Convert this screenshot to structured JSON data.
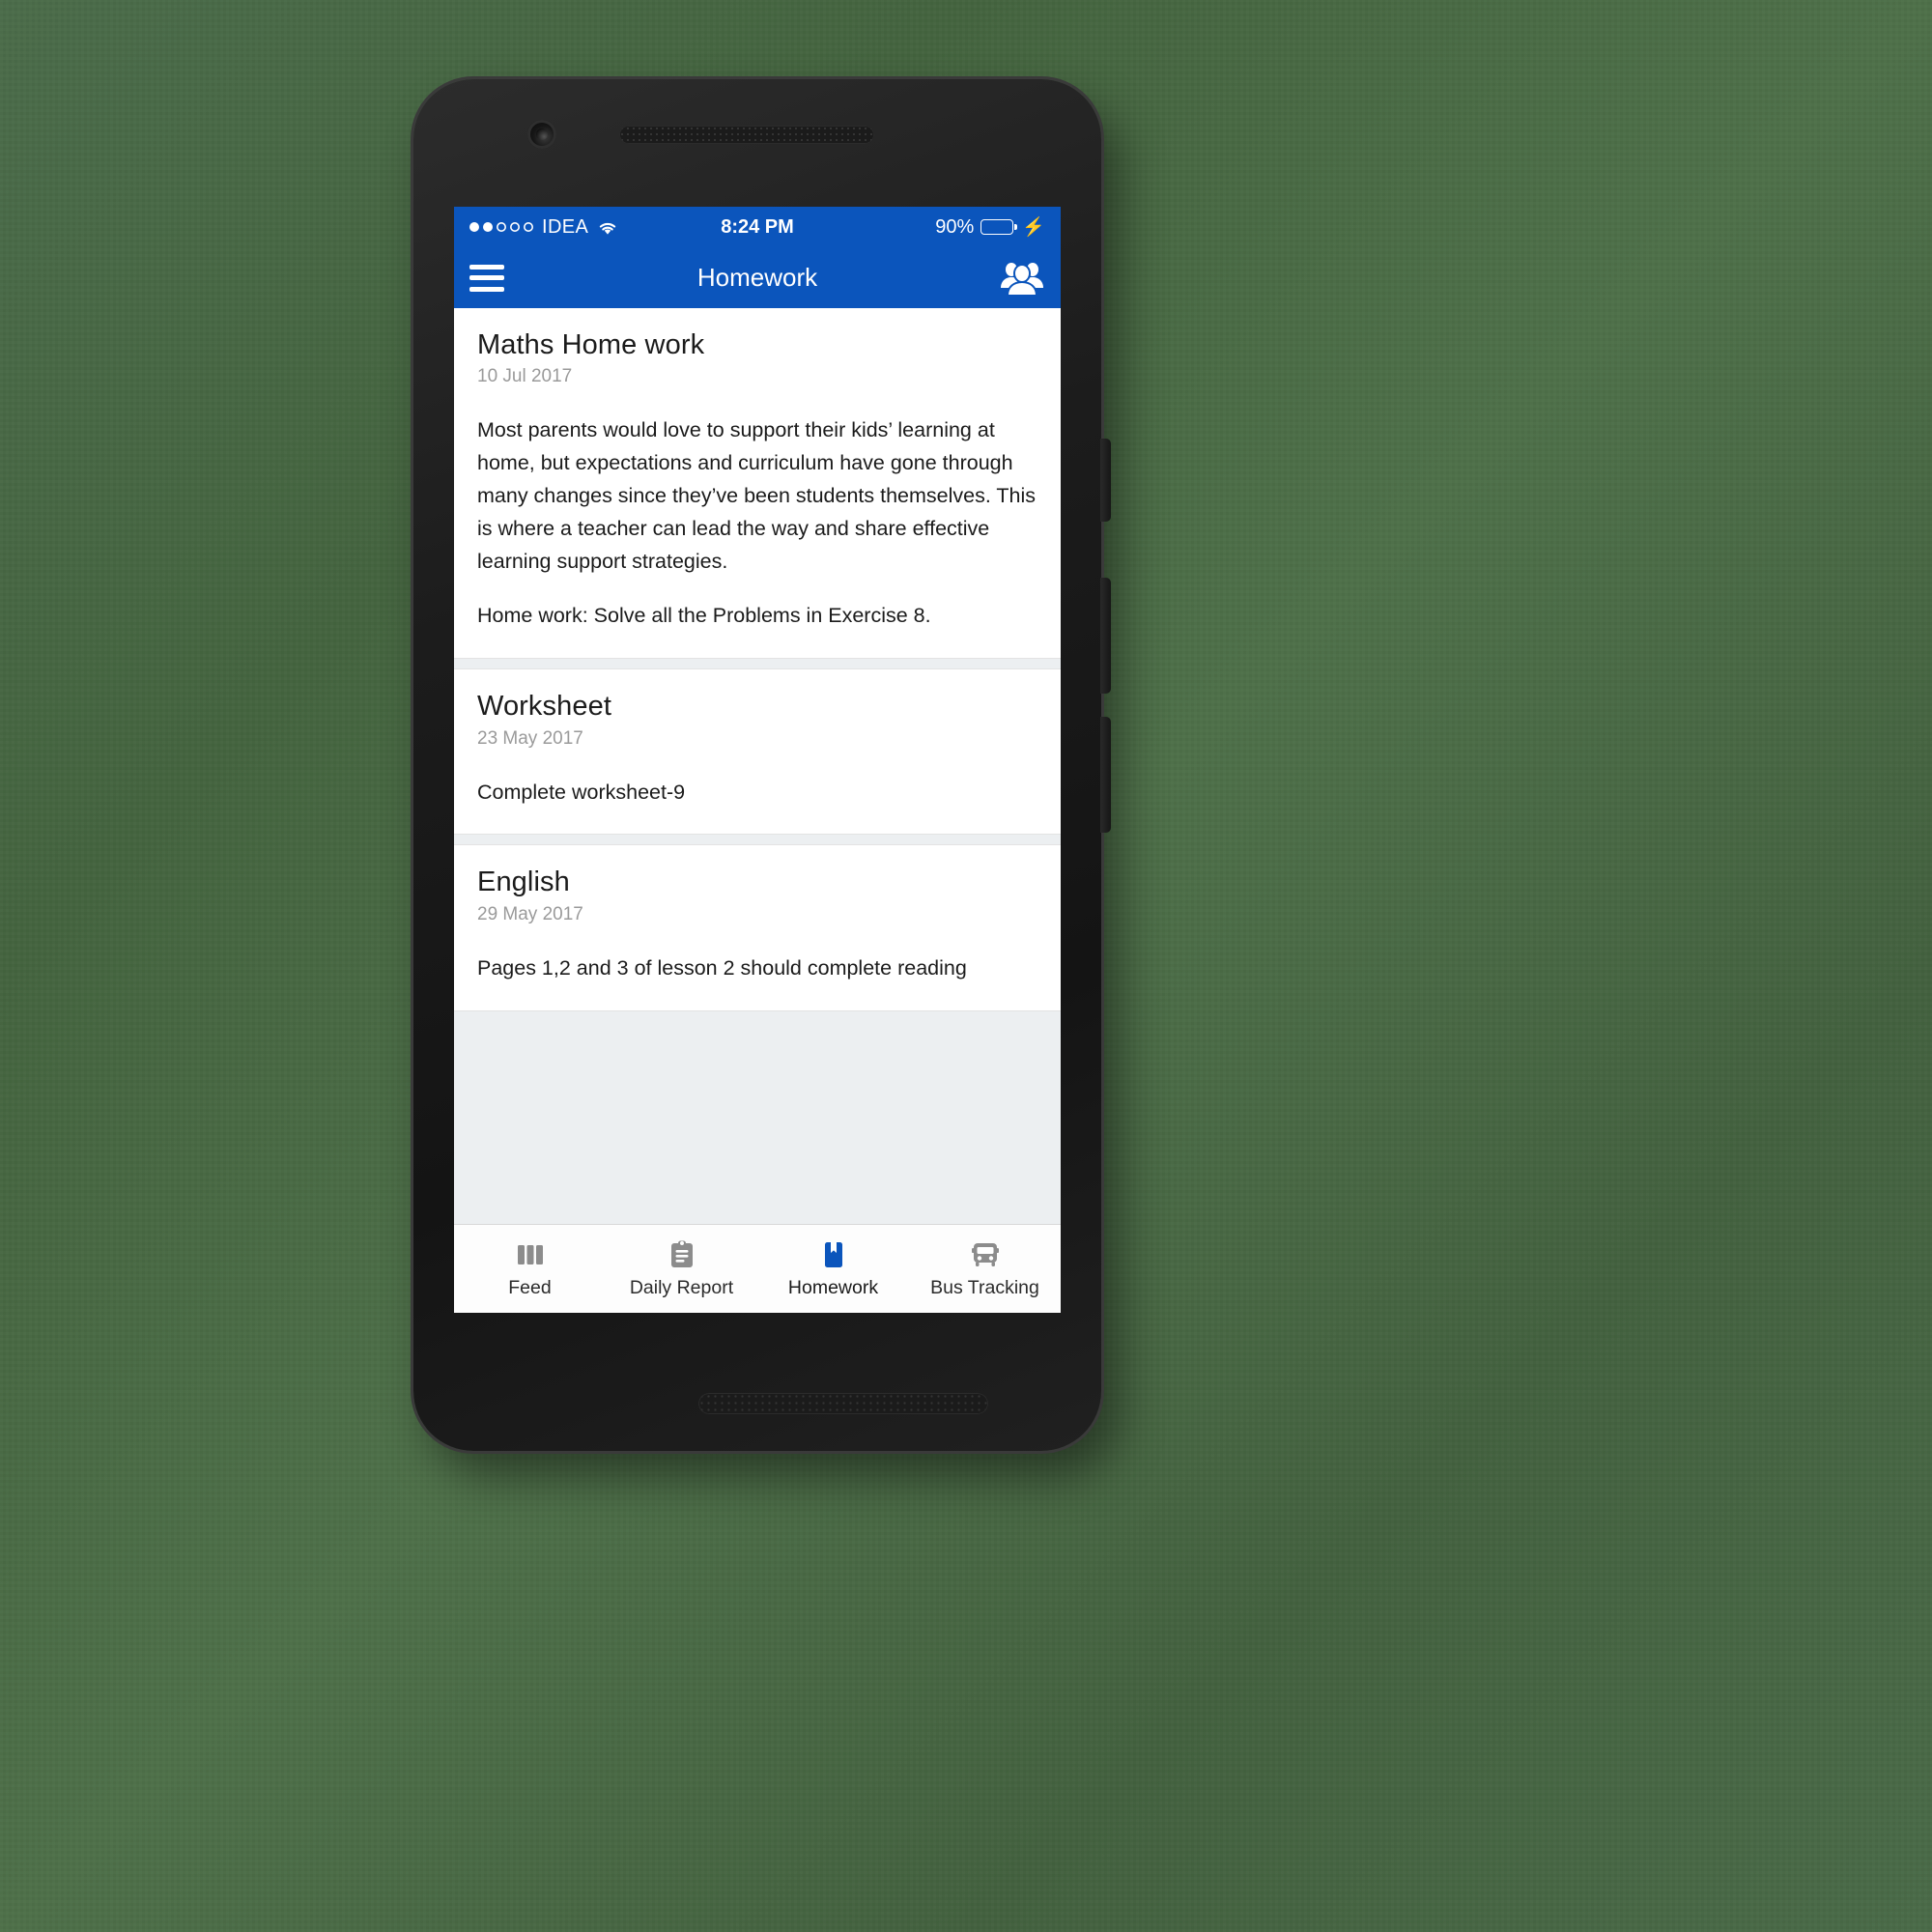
{
  "status_bar": {
    "signal_dots_filled": 2,
    "signal_dots_total": 5,
    "carrier": "IDEA",
    "wifi_icon": "wifi-icon",
    "time": "8:24 PM",
    "battery_percent": "90%",
    "battery_level": 90,
    "charging": true,
    "charging_icon": "lightning-bolt-icon",
    "battery_color": "#4cd850",
    "background_color": "#0b55bc"
  },
  "app_bar": {
    "menu_icon": "hamburger-menu-icon",
    "title": "Homework",
    "action_icon": "group-people-icon",
    "background_color": "#0b55bc",
    "text_color": "#ffffff"
  },
  "cards": [
    {
      "title": "Maths Home work",
      "date": "10 Jul 2017",
      "paragraphs": [
        "Most parents would love to support their kids’ learning at home, but expectations and curriculum have gone through many changes since they’ve been students themselves. This is where a teacher can lead the way and share effective learning support strategies.",
        "Home work: Solve all the Problems in Exercise 8."
      ]
    },
    {
      "title": "Worksheet",
      "date": "23 May 2017",
      "paragraphs": [
        "Complete worksheet-9"
      ]
    },
    {
      "title": "English",
      "date": "29 May 2017",
      "paragraphs": [
        "Pages 1,2 and 3 of lesson 2 should complete reading"
      ]
    }
  ],
  "tab_bar": {
    "active_color": "#0b55bc",
    "inactive_color": "#8c8c8c",
    "tabs": [
      {
        "label": "Feed",
        "icon": "bar-chart-icon",
        "active": false
      },
      {
        "label": "Daily Report",
        "icon": "clipboard-icon",
        "active": false
      },
      {
        "label": "Homework",
        "icon": "bookmark-book-icon",
        "active": true
      },
      {
        "label": "Bus Tracking",
        "icon": "bus-icon",
        "active": false
      }
    ]
  }
}
